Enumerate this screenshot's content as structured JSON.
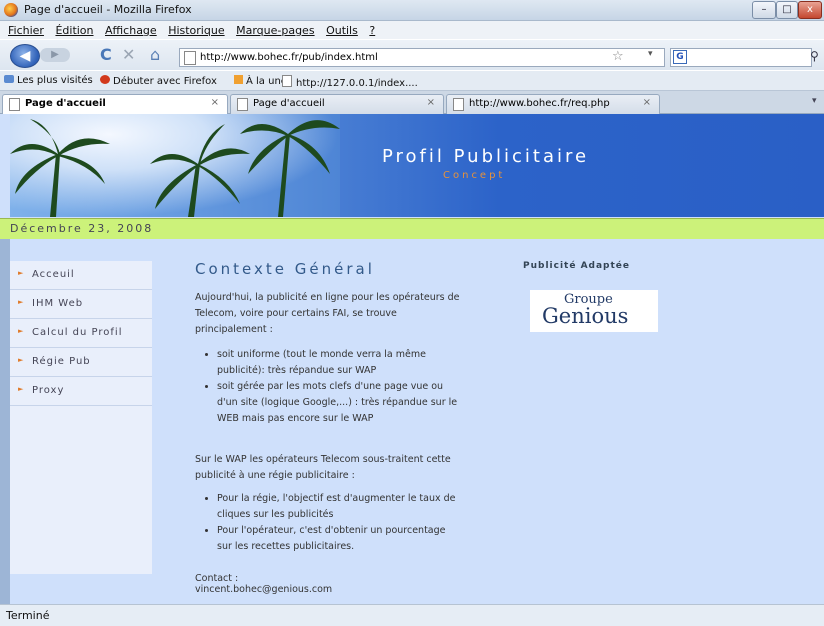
{
  "window": {
    "title": "Page d'accueil - Mozilla Firefox",
    "minimize": "–",
    "maximize": "□",
    "close": "x"
  },
  "menu": [
    "Fichier",
    "Édition",
    "Affichage",
    "Historique",
    "Marque-pages",
    "Outils",
    "?"
  ],
  "nav": {
    "back": "◀",
    "forward": "▶",
    "reload": "C",
    "stop": "✕",
    "home": "⌂",
    "url": "http://www.bohec.fr/pub/index.html",
    "star": "☆",
    "dropdown": "▾",
    "search_engine": "G",
    "search_placeholder": ""
  },
  "bookmarks": [
    "Les plus visités",
    "Débuter avec Firefox",
    "À la une",
    "http://127.0.0.1/index...."
  ],
  "tabs": [
    {
      "label": "Page d'accueil",
      "close": "×"
    },
    {
      "label": "Page d'accueil",
      "close": "×"
    },
    {
      "label": "http://www.bohec.fr/req.php",
      "close": "×"
    }
  ],
  "page": {
    "banner_title": "Profil Publicitaire",
    "banner_subtitle": "Concept",
    "date": "Décembre 23, 2008",
    "sidebar": [
      "Acceuil",
      "IHM Web",
      "Calcul du Profil",
      "Régie Pub",
      "Proxy"
    ],
    "heading": "Contexte Général",
    "intro": "Aujourd'hui, la publicité en ligne pour les opérateurs de Telecom, voire pour certains FAI, se trouve principalement :",
    "bullets1": [
      "soit uniforme (tout le monde verra la même publicité): très répandue sur WAP",
      "soit gérée par les mots clefs d'une page vue ou d'un site (logique Google,...) : très répandue sur le WEB mais pas encore sur le WAP"
    ],
    "para2": "Sur le WAP les opérateurs Telecom sous-traitent cette publicité à une régie publicitaire :",
    "bullets2": [
      "Pour la régie, l'objectif est d'augmenter le taux de cliques sur les publicités",
      "Pour l'opérateur, c'est d'obtenir un pourcentage sur les recettes publicitaires."
    ],
    "contact_label": "Contact :",
    "contact_email": "vincent.bohec@genious.com",
    "side_heading": "Publicité Adaptée",
    "logo_line1": "Groupe",
    "logo_line2": "Genious"
  },
  "status": "Terminé"
}
